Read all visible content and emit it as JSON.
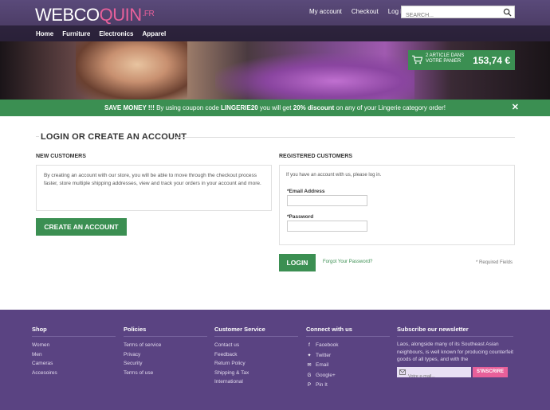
{
  "logo": {
    "part1": "WEBCO",
    "part2": "QUIN",
    "tld": ".FR"
  },
  "header": {
    "links": [
      "My account",
      "Checkout",
      "Log in"
    ],
    "search_placeholder": "SEARCH..."
  },
  "nav": [
    "Home",
    "Furniture",
    "Electronics",
    "Apparel"
  ],
  "cart": {
    "line1": "2 ARTICLE DANS",
    "line2": "VOTRE PANIER",
    "total": "153,74 €"
  },
  "promo": {
    "lead": "SAVE MONEY !!!",
    "text1": " By using coupon code ",
    "code": "LINGERIE20",
    "text2": " you will get ",
    "discount": "20% discount",
    "text3": " on any of your Lingerie category order!",
    "close": "✕"
  },
  "page": {
    "title": "LOGIN OR CREATE AN ACCOUNT",
    "new_customers": {
      "heading": "NEW CUSTOMERS",
      "text": "By creating an account with our store, you will be able to move through the checkout process faster, store multiple shipping addresses, view and track your orders in your account and more.",
      "button": "CREATE AN ACCOUNT"
    },
    "registered": {
      "heading": "REGISTERED CUSTOMERS",
      "intro": "If you have an account with us, please log in.",
      "email_label": "*Email Address",
      "password_label": "*Password",
      "button": "LOGIN",
      "forgot": "Forgot Your Password?",
      "required": "* Required Fields"
    }
  },
  "footer": {
    "shop": {
      "title": "Shop",
      "items": [
        "Women",
        "Men",
        "Cameras",
        "Accesoires"
      ]
    },
    "policies": {
      "title": "Policies",
      "items": [
        "Terms of service",
        "Privacy",
        "Security",
        "Terms of use"
      ]
    },
    "service": {
      "title": "Customer Service",
      "items": [
        "Contact us",
        "Feedback",
        "Return Policy",
        "Shipping & Tax",
        "International"
      ]
    },
    "connect": {
      "title": "Connect with us",
      "items": [
        {
          "icon": "facebook-icon",
          "label": "Facebook"
        },
        {
          "icon": "twitter-icon",
          "label": "Twitter"
        },
        {
          "icon": "email-icon",
          "label": "Email"
        },
        {
          "icon": "google-plus-icon",
          "label": "Google+"
        },
        {
          "icon": "pinterest-icon",
          "label": "Pin It"
        }
      ]
    },
    "newsletter": {
      "title": "Subscribe our newsletter",
      "text": "Laos, alongside many of its Southeast Asian neighbours, is well known for producing counterfeit goods of all types, and with the",
      "placeholder": "Votre e-mail...",
      "button": "S'INSCRIRE"
    }
  },
  "colors": {
    "green": "#3b8f52",
    "purple": "#5a4382",
    "pink": "#e8609a"
  }
}
